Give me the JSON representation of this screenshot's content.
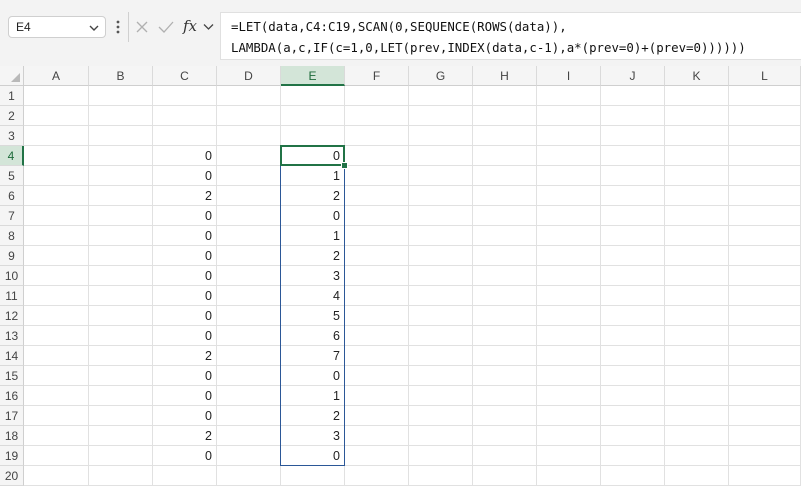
{
  "name_box": {
    "value": "E4"
  },
  "formula_bar": {
    "fx_label": "fx",
    "lines": [
      "=LET(data,C4:C19,SCAN(0,SEQUENCE(ROWS(data)),",
      "LAMBDA(a,c,IF(c=1,0,LET(prev,INDEX(data,c-1),a*(prev=0)+(prev=0))))))"
    ]
  },
  "columns": [
    "A",
    "B",
    "C",
    "D",
    "E",
    "F",
    "G",
    "H",
    "I",
    "J",
    "K",
    "L"
  ],
  "rows": [
    "1",
    "2",
    "3",
    "4",
    "5",
    "6",
    "7",
    "8",
    "9",
    "10",
    "11",
    "12",
    "13",
    "14",
    "15",
    "16",
    "17",
    "18",
    "19",
    "20"
  ],
  "selection": {
    "active_cell": "E4",
    "range": "E4:E19",
    "active_column": "E",
    "active_row": "4"
  },
  "column_c_values": [
    "0",
    "0",
    "2",
    "0",
    "0",
    "0",
    "0",
    "0",
    "0",
    "0",
    "2",
    "0",
    "0",
    "0",
    "2",
    "0"
  ],
  "column_e_values": [
    "0",
    "1",
    "2",
    "0",
    "1",
    "2",
    "3",
    "4",
    "5",
    "6",
    "7",
    "0",
    "1",
    "2",
    "3",
    "0"
  ],
  "colors": {
    "accent_green": "#217346",
    "selection_blue": "#2b5797",
    "header_active_bg": "#d3e5d8"
  }
}
